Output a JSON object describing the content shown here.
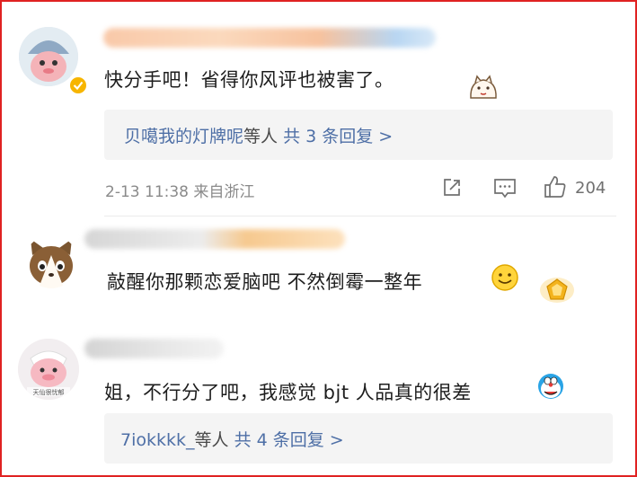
{
  "comments": [
    {
      "text": "快分手吧！省得你风评也被害了。",
      "reply": {
        "names": "贝噶我的灯牌呢",
        "others": "等人",
        "count": "共 3 条回复 >"
      },
      "meta": {
        "date": "2-13",
        "time": "11:38",
        "source": "来自浙江",
        "likes": "204"
      }
    },
    {
      "text": "敲醒你那颗恋爱脑吧 不然倒霉一整年"
    },
    {
      "text": "姐，不行分了吧，我感觉 bjt 人品真的很差",
      "reply": {
        "names": "7iokkkk_",
        "others": "等人",
        "count": "共 4 条回复 >"
      }
    }
  ],
  "avatar3_caption": "天仙很忧郁",
  "colors": {
    "frame": "#e02222",
    "link": "#4e6fa6",
    "verified": "#f7b500"
  }
}
